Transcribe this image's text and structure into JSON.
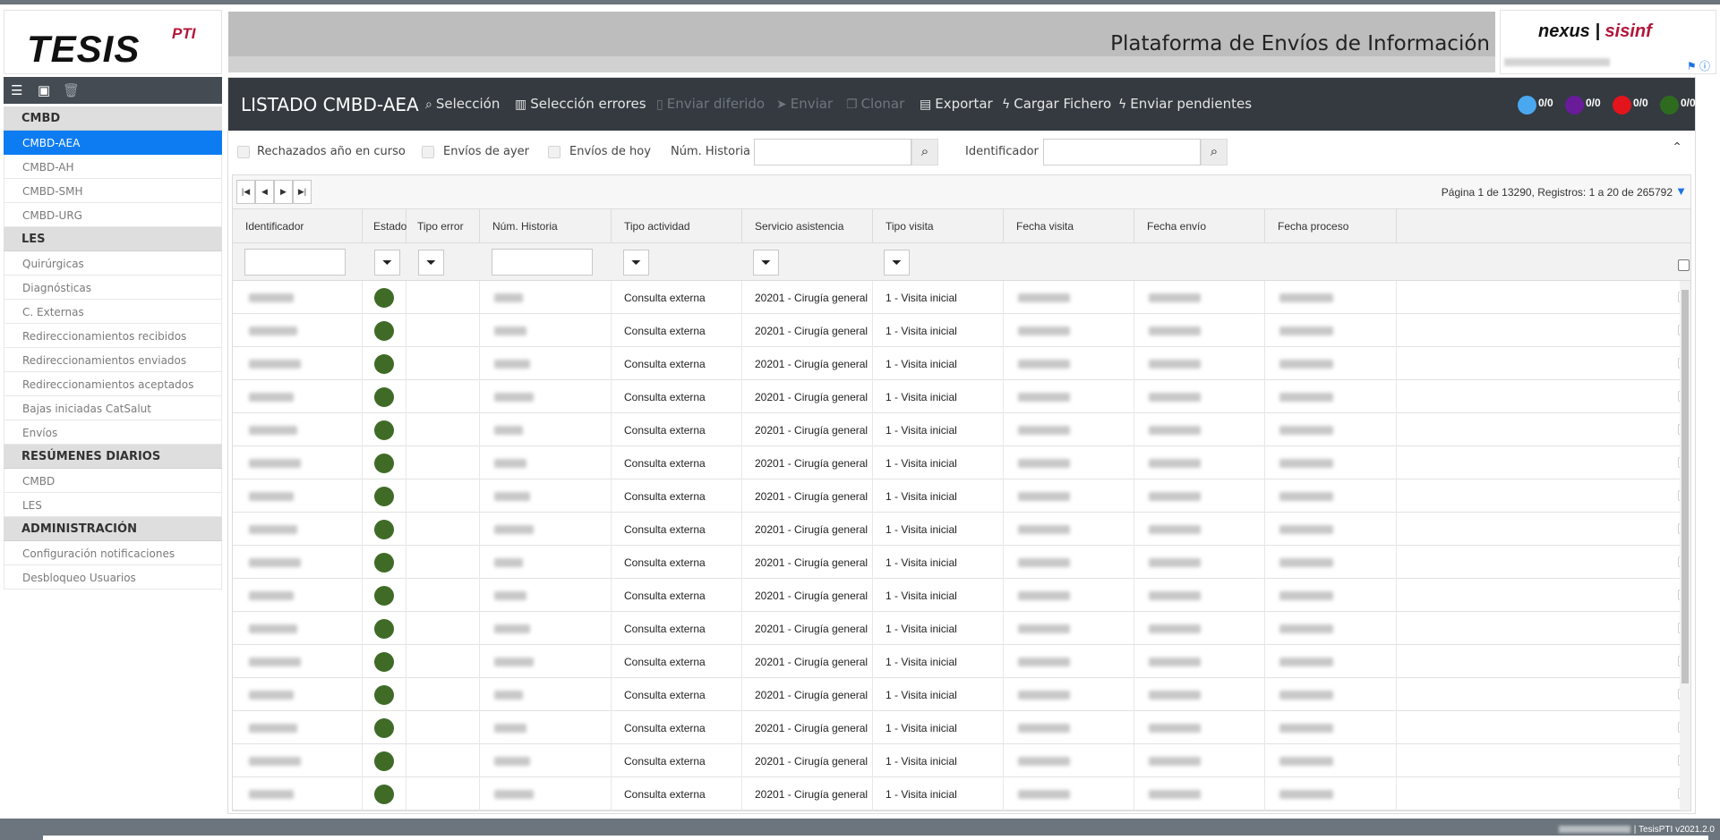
{
  "header": {
    "logo": "TESIS",
    "logo_sup": "PTI",
    "banner_title": "Plataforma de Envíos de Información",
    "partner_logo_left": "nexus",
    "partner_logo_right": "sisinf"
  },
  "sidebar": {
    "groups": [
      {
        "label": "CMBD",
        "items": [
          "CMBD-AEA",
          "CMBD-AH",
          "CMBD-SMH",
          "CMBD-URG"
        ]
      },
      {
        "label": "LES",
        "items": [
          "Quirúrgicas",
          "Diagnósticas",
          "C. Externas",
          "Redireccionamientos recibidos",
          "Redireccionamientos enviados",
          "Redireccionamientos aceptados",
          "Bajas iniciadas CatSalut",
          "Envíos"
        ]
      },
      {
        "label": "RESÚMENES DIARIOS",
        "items": [
          "CMBD",
          "LES"
        ]
      },
      {
        "label": "ADMINISTRACIÓN",
        "items": [
          "Configuración notificaciones",
          "Desbloqueo Usuarios"
        ]
      }
    ],
    "active": "CMBD-AEA"
  },
  "toolbar": {
    "title": "LISTADO CMBD-AEA",
    "seleccion": "Selección",
    "seleccion_errores": "Selección errores",
    "enviar_diferido": "Enviar diferido",
    "enviar": "Enviar",
    "clonar": "Clonar",
    "exportar": "Exportar",
    "cargar_fichero": "Cargar Fichero",
    "enviar_pendientes": "Enviar pendientes",
    "counters": [
      {
        "value": "0/0",
        "color": "#4aa8f0"
      },
      {
        "value": "0/0",
        "color": "#6a1b9a"
      },
      {
        "value": "0/0",
        "color": "#e3141b"
      },
      {
        "value": "0/0",
        "color": "#2e6b1f"
      }
    ]
  },
  "filters": {
    "rechazados": "Rechazados año en curso",
    "ayer": "Envíos de ayer",
    "hoy": "Envíos de hoy",
    "num_historia": "Núm. Historia",
    "identificador": "Identificador"
  },
  "pager": {
    "info": "Página 1 de 13290, Registros: 1 a 20 de 265792"
  },
  "table": {
    "columns": [
      "Identificador",
      "Estado",
      "Tipo error",
      "Núm. Historia",
      "Tipo actividad",
      "Servicio asistencia",
      "Tipo visita",
      "Fecha visita",
      "Fecha envío",
      "Fecha proceso"
    ],
    "rows": [
      {
        "tipo_actividad": "Consulta externa",
        "servicio": "20201 - Cirugía general",
        "tipo_visita": "1 - Visita inicial"
      },
      {
        "tipo_actividad": "Consulta externa",
        "servicio": "20201 - Cirugía general",
        "tipo_visita": "1 - Visita inicial"
      },
      {
        "tipo_actividad": "Consulta externa",
        "servicio": "20201 - Cirugía general",
        "tipo_visita": "1 - Visita inicial"
      },
      {
        "tipo_actividad": "Consulta externa",
        "servicio": "20201 - Cirugía general",
        "tipo_visita": "1 - Visita inicial"
      },
      {
        "tipo_actividad": "Consulta externa",
        "servicio": "20201 - Cirugía general",
        "tipo_visita": "1 - Visita inicial"
      },
      {
        "tipo_actividad": "Consulta externa",
        "servicio": "20201 - Cirugía general",
        "tipo_visita": "1 - Visita inicial"
      },
      {
        "tipo_actividad": "Consulta externa",
        "servicio": "20201 - Cirugía general",
        "tipo_visita": "1 - Visita inicial"
      },
      {
        "tipo_actividad": "Consulta externa",
        "servicio": "20201 - Cirugía general",
        "tipo_visita": "1 - Visita inicial"
      },
      {
        "tipo_actividad": "Consulta externa",
        "servicio": "20201 - Cirugía general",
        "tipo_visita": "1 - Visita inicial"
      },
      {
        "tipo_actividad": "Consulta externa",
        "servicio": "20201 - Cirugía general",
        "tipo_visita": "1 - Visita inicial"
      },
      {
        "tipo_actividad": "Consulta externa",
        "servicio": "20201 - Cirugía general",
        "tipo_visita": "1 - Visita inicial"
      },
      {
        "tipo_actividad": "Consulta externa",
        "servicio": "20201 - Cirugía general",
        "tipo_visita": "1 - Visita inicial"
      },
      {
        "tipo_actividad": "Consulta externa",
        "servicio": "20201 - Cirugía general",
        "tipo_visita": "1 - Visita inicial"
      },
      {
        "tipo_actividad": "Consulta externa",
        "servicio": "20201 - Cirugía general",
        "tipo_visita": "1 - Visita inicial"
      },
      {
        "tipo_actividad": "Consulta externa",
        "servicio": "20201 - Cirugía general",
        "tipo_visita": "1 - Visita inicial"
      },
      {
        "tipo_actividad": "Consulta externa",
        "servicio": "20201 - Cirugía general",
        "tipo_visita": "1 - Visita inicial"
      }
    ],
    "status_color": "#3f6b27"
  },
  "footer": {
    "version": "| TesisPTI v2021.2.0"
  }
}
